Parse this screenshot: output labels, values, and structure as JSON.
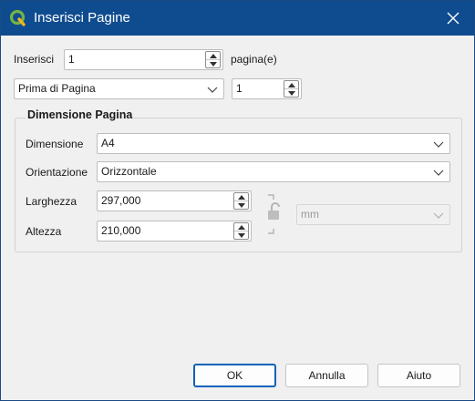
{
  "window": {
    "title": "Inserisci Pagine",
    "app_icon": "qgis-logo-icon",
    "close_icon": "close-icon"
  },
  "insert": {
    "label": "Inserisci",
    "value": "1",
    "suffix": "pagina(e)"
  },
  "position": {
    "selected": "Prima di Pagina",
    "page_value": "1"
  },
  "page_size": {
    "group_title": "Dimensione Pagina",
    "size_label": "Dimensione",
    "size_value": "A4",
    "orientation_label": "Orientazione",
    "orientation_value": "Orizzontale",
    "width_label": "Larghezza",
    "width_value": "297,000",
    "height_label": "Altezza",
    "height_value": "210,000",
    "lock_icon": "unlocked-padlock-icon",
    "units_value": "mm"
  },
  "buttons": {
    "ok": "OK",
    "cancel": "Annulla",
    "help": "Aiuto"
  },
  "colors": {
    "titlebar": "#0f4c8f",
    "default_button_border": "#0f62b8",
    "qgis_green": "#589632",
    "qgis_yellow": "#ee7913"
  }
}
